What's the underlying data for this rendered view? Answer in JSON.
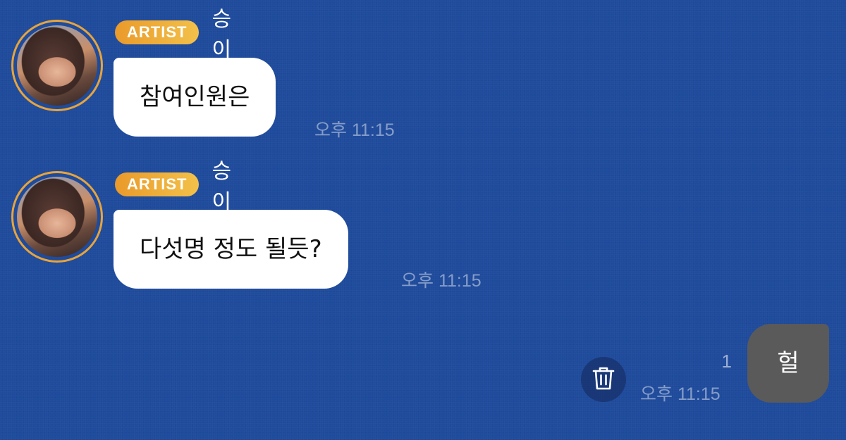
{
  "messages": [
    {
      "badge": "ARTIST",
      "sender": "승이",
      "text": "참여인원은",
      "time": "오후 11:15"
    },
    {
      "badge": "ARTIST",
      "sender": "승이",
      "text": "다섯명 정도 될듯?",
      "time": "오후 11:15"
    }
  ],
  "outgoing": {
    "text": "헐",
    "unread_count": "1",
    "time": "오후 11:15"
  },
  "icons": {
    "delete": "trash-icon"
  },
  "colors": {
    "background": "#1f4b9c",
    "badge_start": "#ea9a2a",
    "badge_end": "#f2c14a",
    "avatar_ring": "#e8a43a",
    "incoming_bubble": "#ffffff",
    "outgoing_bubble": "#5a5a5a"
  }
}
